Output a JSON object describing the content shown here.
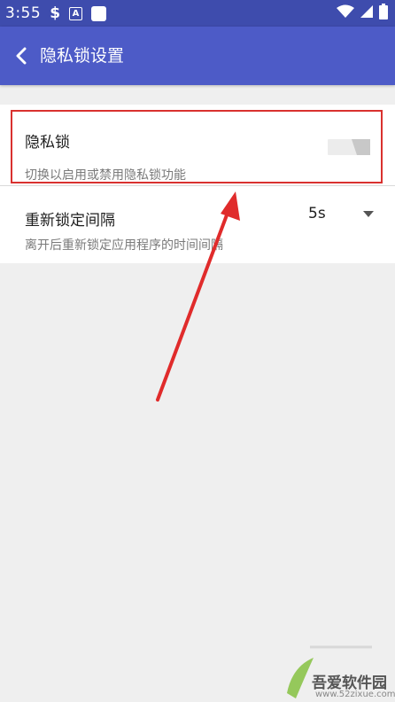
{
  "status_bar": {
    "time": "3:55",
    "icons": [
      "s-notification-icon",
      "a-notification-icon",
      "app-notification-icon",
      "wifi-icon",
      "signal-icon",
      "battery-icon"
    ]
  },
  "app_bar": {
    "title": "隐私锁设置",
    "back_icon": "chevron-left-icon"
  },
  "settings": {
    "privacy_lock": {
      "title": "隐私锁",
      "subtitle": "切换以启用或禁用隐私锁功能",
      "enabled": false
    },
    "relock_interval": {
      "title": "重新锁定间隔",
      "subtitle": "离开后重新锁定应用程序的时间间隔",
      "value": "5s"
    }
  },
  "colors": {
    "status_bar": "#3e4cad",
    "app_bar": "#4d5bc7",
    "highlight": "#d9312f",
    "arrow": "#e02b2b"
  },
  "watermark": {
    "name": "吾爱软件园",
    "url": "www.52zixue.com"
  }
}
